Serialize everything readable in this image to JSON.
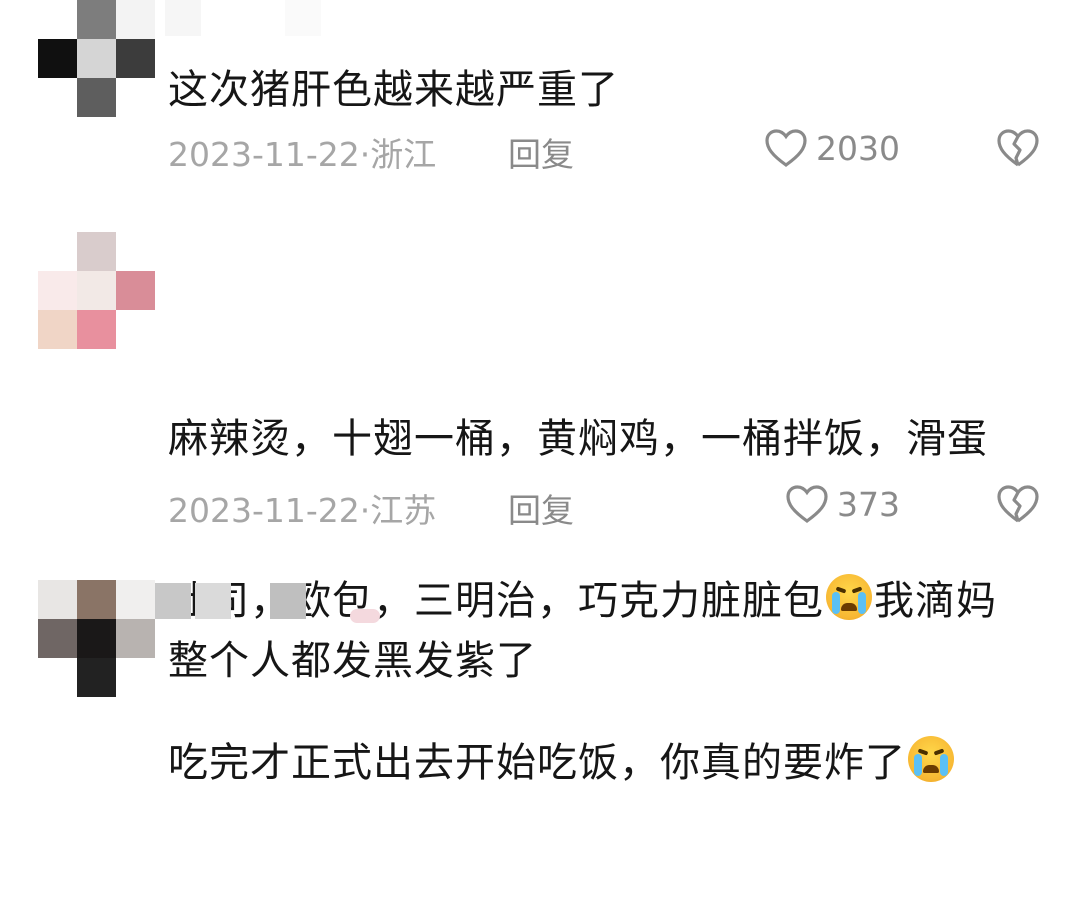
{
  "comments": [
    {
      "text": "这次猪肝色越来越严重了",
      "date": "2023-11-22·",
      "location": "浙江",
      "reply_label": "回复",
      "likes": "2030"
    },
    {
      "text_lines": [
        "麻辣烫，十翅一桶，黄焖鸡，一桶拌饭，滑蛋",
        "吐司，欧包，三明治，巧克力脏脏包",
        "我滴妈",
        "吃完才正式出去开始吃饭，你真的要炸了"
      ],
      "date": "2023-11-22·",
      "location": "江苏",
      "reply_label": "回复",
      "likes": "373"
    },
    {
      "text": "整个人都发黑发紫了"
    }
  ],
  "icons": {
    "like": "heart-outline-icon",
    "dislike": "broken-heart-icon",
    "emoji": "crying-face-emoji-icon"
  },
  "colors": {
    "text": "#161616",
    "meta": "#a6a6a6"
  }
}
